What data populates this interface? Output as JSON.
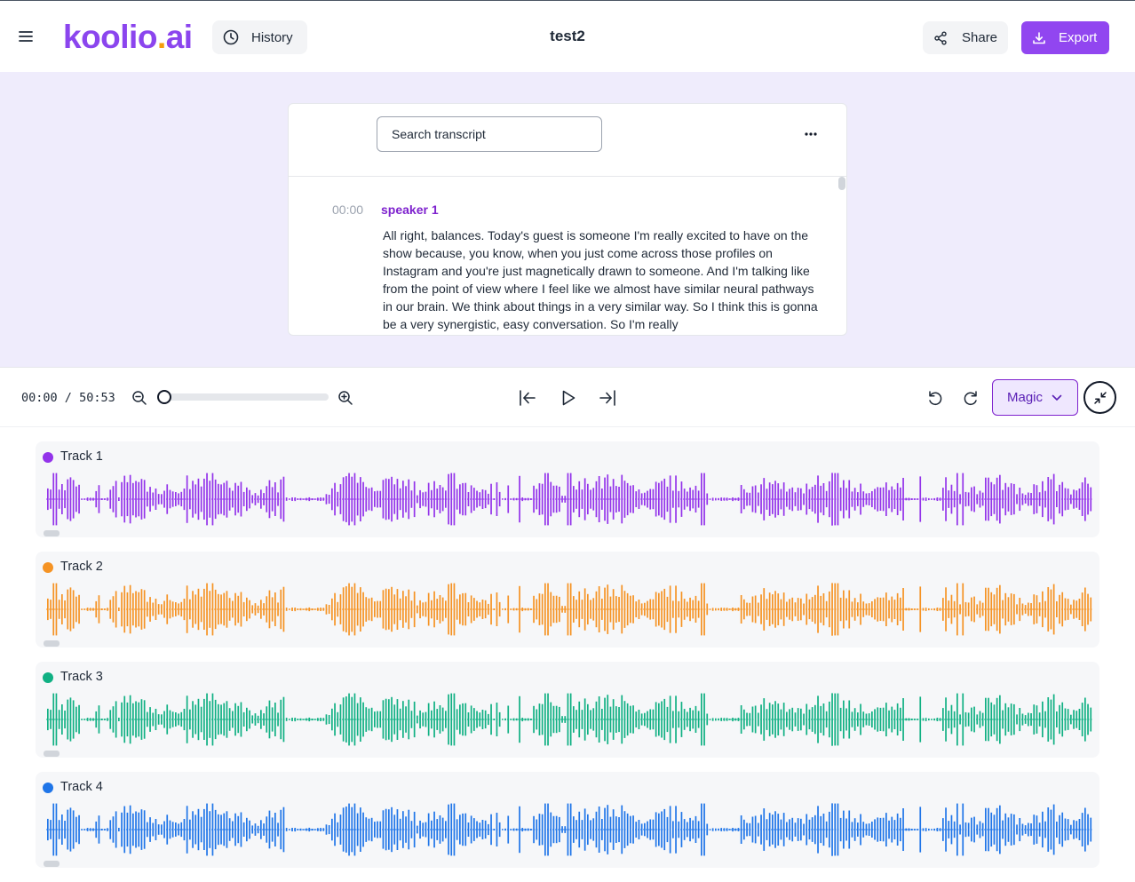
{
  "header": {
    "logo_main": "koolio",
    "logo_dot": ".",
    "logo_suffix": "ai",
    "history_label": "History",
    "title": "test2",
    "share_label": "Share",
    "export_label": "Export"
  },
  "transcript": {
    "search_placeholder": "Search transcript",
    "entries": [
      {
        "time": "00:00",
        "speaker": "speaker 1",
        "text": "All right, balances. Today's guest is someone I'm really excited to have on the show because, you know, when you just come across those profiles on Instagram and you're just magnetically drawn to someone. And I'm talking like from the point of view where I feel like we almost have similar neural pathways in our brain. We think about things in a very similar way. So I think this is gonna be a very synergistic, easy conversation. So I'm really"
      }
    ]
  },
  "player": {
    "current_time": "00:00",
    "separator": "/",
    "total_time": "50:53",
    "zoom_level": 0,
    "magic_label": "Magic"
  },
  "tracks": [
    {
      "name": "Track 1",
      "color": "#9333ea"
    },
    {
      "name": "Track 2",
      "color": "#f59324"
    },
    {
      "name": "Track 3",
      "color": "#10b083"
    },
    {
      "name": "Track 4",
      "color": "#1f75e8"
    }
  ],
  "colors": {
    "accent": "#9146f0",
    "transcript_bg": "#efecfc",
    "speaker": "#7e22ce"
  },
  "icons": {
    "menu": "hamburger-menu-icon",
    "history": "clock-icon",
    "share": "share-icon",
    "export": "download-icon",
    "more": "ellipsis-icon",
    "zoom_out": "zoom-out-icon",
    "zoom_in": "zoom-in-icon",
    "skip_start": "skip-to-start-icon",
    "play": "play-icon",
    "skip_end": "skip-to-end-icon",
    "undo": "undo-icon",
    "redo": "redo-icon",
    "magic": "chevron-down-icon",
    "collapse": "collapse-icon"
  }
}
